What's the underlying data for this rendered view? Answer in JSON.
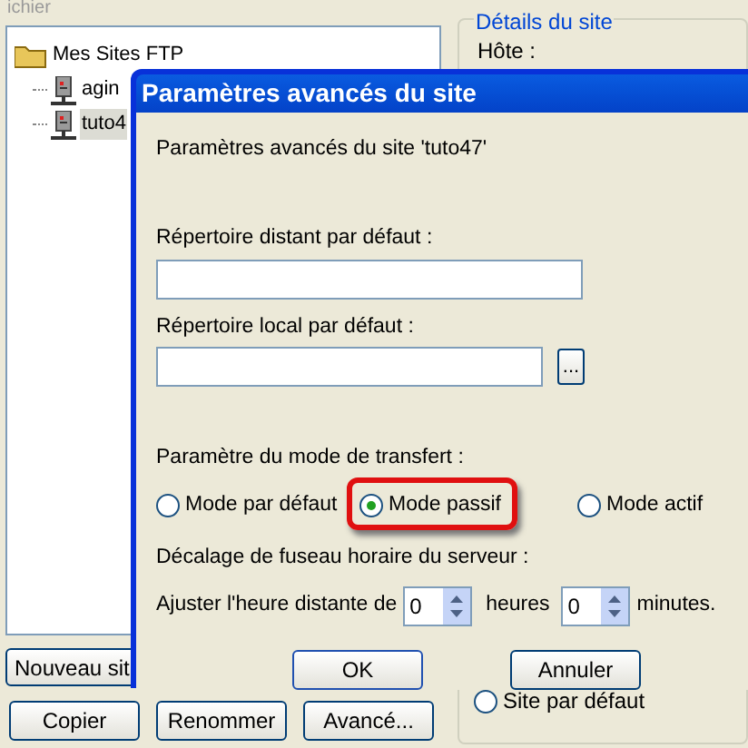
{
  "background": {
    "menu_text": "ichier",
    "tree": [
      {
        "label": "Mes Sites FTP",
        "selected": false,
        "children": [
          {
            "label": "agin",
            "selected": false
          },
          {
            "label": "tuto4",
            "selected": true
          }
        ]
      }
    ],
    "new_site_button": "Nouveau sit",
    "buttons": [
      "Copier",
      "Renommer",
      "Avancé..."
    ],
    "details": {
      "title": "Détails du site",
      "host_label": "Hôte :",
      "default_site": {
        "label": "Site par défaut",
        "selected": false
      }
    }
  },
  "dialog": {
    "title": "Paramètres avancés du site",
    "intro": "Paramètres avancés du site 'tuto47'",
    "remote_dir": {
      "label": "Répertoire distant par défaut :"
    },
    "local_dir": {
      "label": "Répertoire local par défaut :",
      "browse_button": "..."
    },
    "transfer_mode": {
      "label": "Paramètre du mode de transfert :",
      "options": [
        {
          "label": "Mode par défaut",
          "selected": false,
          "highlighted": false
        },
        {
          "label": "Mode passif",
          "selected": true,
          "highlighted": true
        },
        {
          "label": "Mode actif",
          "selected": false,
          "highlighted": false
        }
      ]
    },
    "timezone": {
      "label": "Décalage de fuseau horaire du serveur :",
      "prefix": "Ajuster l'heure distante de",
      "hours": "0",
      "hours_unit": "heures",
      "minutes": "0",
      "minutes_unit": "minutes."
    },
    "buttons": [
      "OK",
      "Annuler"
    ]
  }
}
